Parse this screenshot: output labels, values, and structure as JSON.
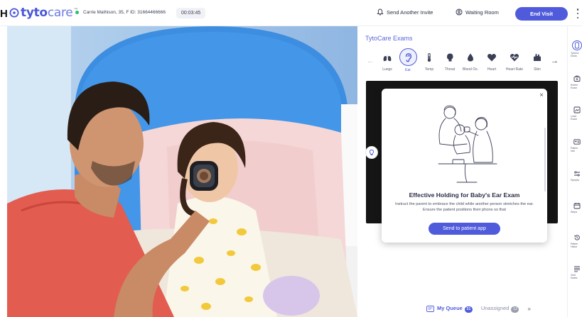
{
  "header": {
    "partial_char": "H",
    "brand_bold": "tyto",
    "brand_light": "care",
    "brand_tm": "™",
    "patient_info": "Carrie Mathison, 35, F  ID: 31664466666",
    "timer": "00:03:45",
    "send_invite_label": "Send Another Invite",
    "waiting_room_label": "Waiting Room",
    "end_visit_label": "End Visit"
  },
  "exams": {
    "title": "TytoCare Exams",
    "items": [
      {
        "label": "Lungs",
        "icon": "lungs-icon"
      },
      {
        "label": "Ear",
        "icon": "ear-icon",
        "active": true
      },
      {
        "label": "Temp",
        "icon": "thermometer-icon"
      },
      {
        "label": "Throat",
        "icon": "throat-icon"
      },
      {
        "label": "Blood Ox.",
        "icon": "blood-drop-icon"
      },
      {
        "label": "Heart",
        "icon": "heart-icon"
      },
      {
        "label": "Heart Rate",
        "icon": "heart-rate-icon"
      },
      {
        "label": "Skin",
        "icon": "skin-icon"
      }
    ]
  },
  "modal": {
    "close": "×",
    "title": "Effective Holding for Baby's Ear Exam",
    "body": "Instruct the parent to embrace the child while another person stretches the ear. Ensure the patient positions their phone so that",
    "button_label": "Send to patient app"
  },
  "queue": {
    "my_queue_label": "My Queue",
    "my_queue_count": "31",
    "unassigned_label": "Unassigned",
    "unassigned_count": "12",
    "chevron": "»"
  },
  "rail": {
    "items": [
      {
        "label1": "TytoCa",
        "label2": "Devic",
        "icon": "device-icon",
        "active": true
      },
      {
        "label1": "Extern",
        "label2": "Exam",
        "icon": "external-exam-icon"
      },
      {
        "label1": "Load",
        "label2": "Exam",
        "icon": "load-exam-icon"
      },
      {
        "label1": "Patien",
        "label2": "Info",
        "icon": "patient-info-icon"
      },
      {
        "label1": "Sympto",
        "label2": "",
        "icon": "symptoms-icon"
      },
      {
        "label1": "Steps",
        "label2": "",
        "icon": "steps-icon"
      },
      {
        "label1": "Patien",
        "label2": "Histor",
        "icon": "history-icon"
      },
      {
        "label1": "Visit",
        "label2": "Notes",
        "icon": "notes-icon"
      }
    ]
  },
  "colors": {
    "accent": "#4f5bdb",
    "status_green": "#2fbf71"
  }
}
